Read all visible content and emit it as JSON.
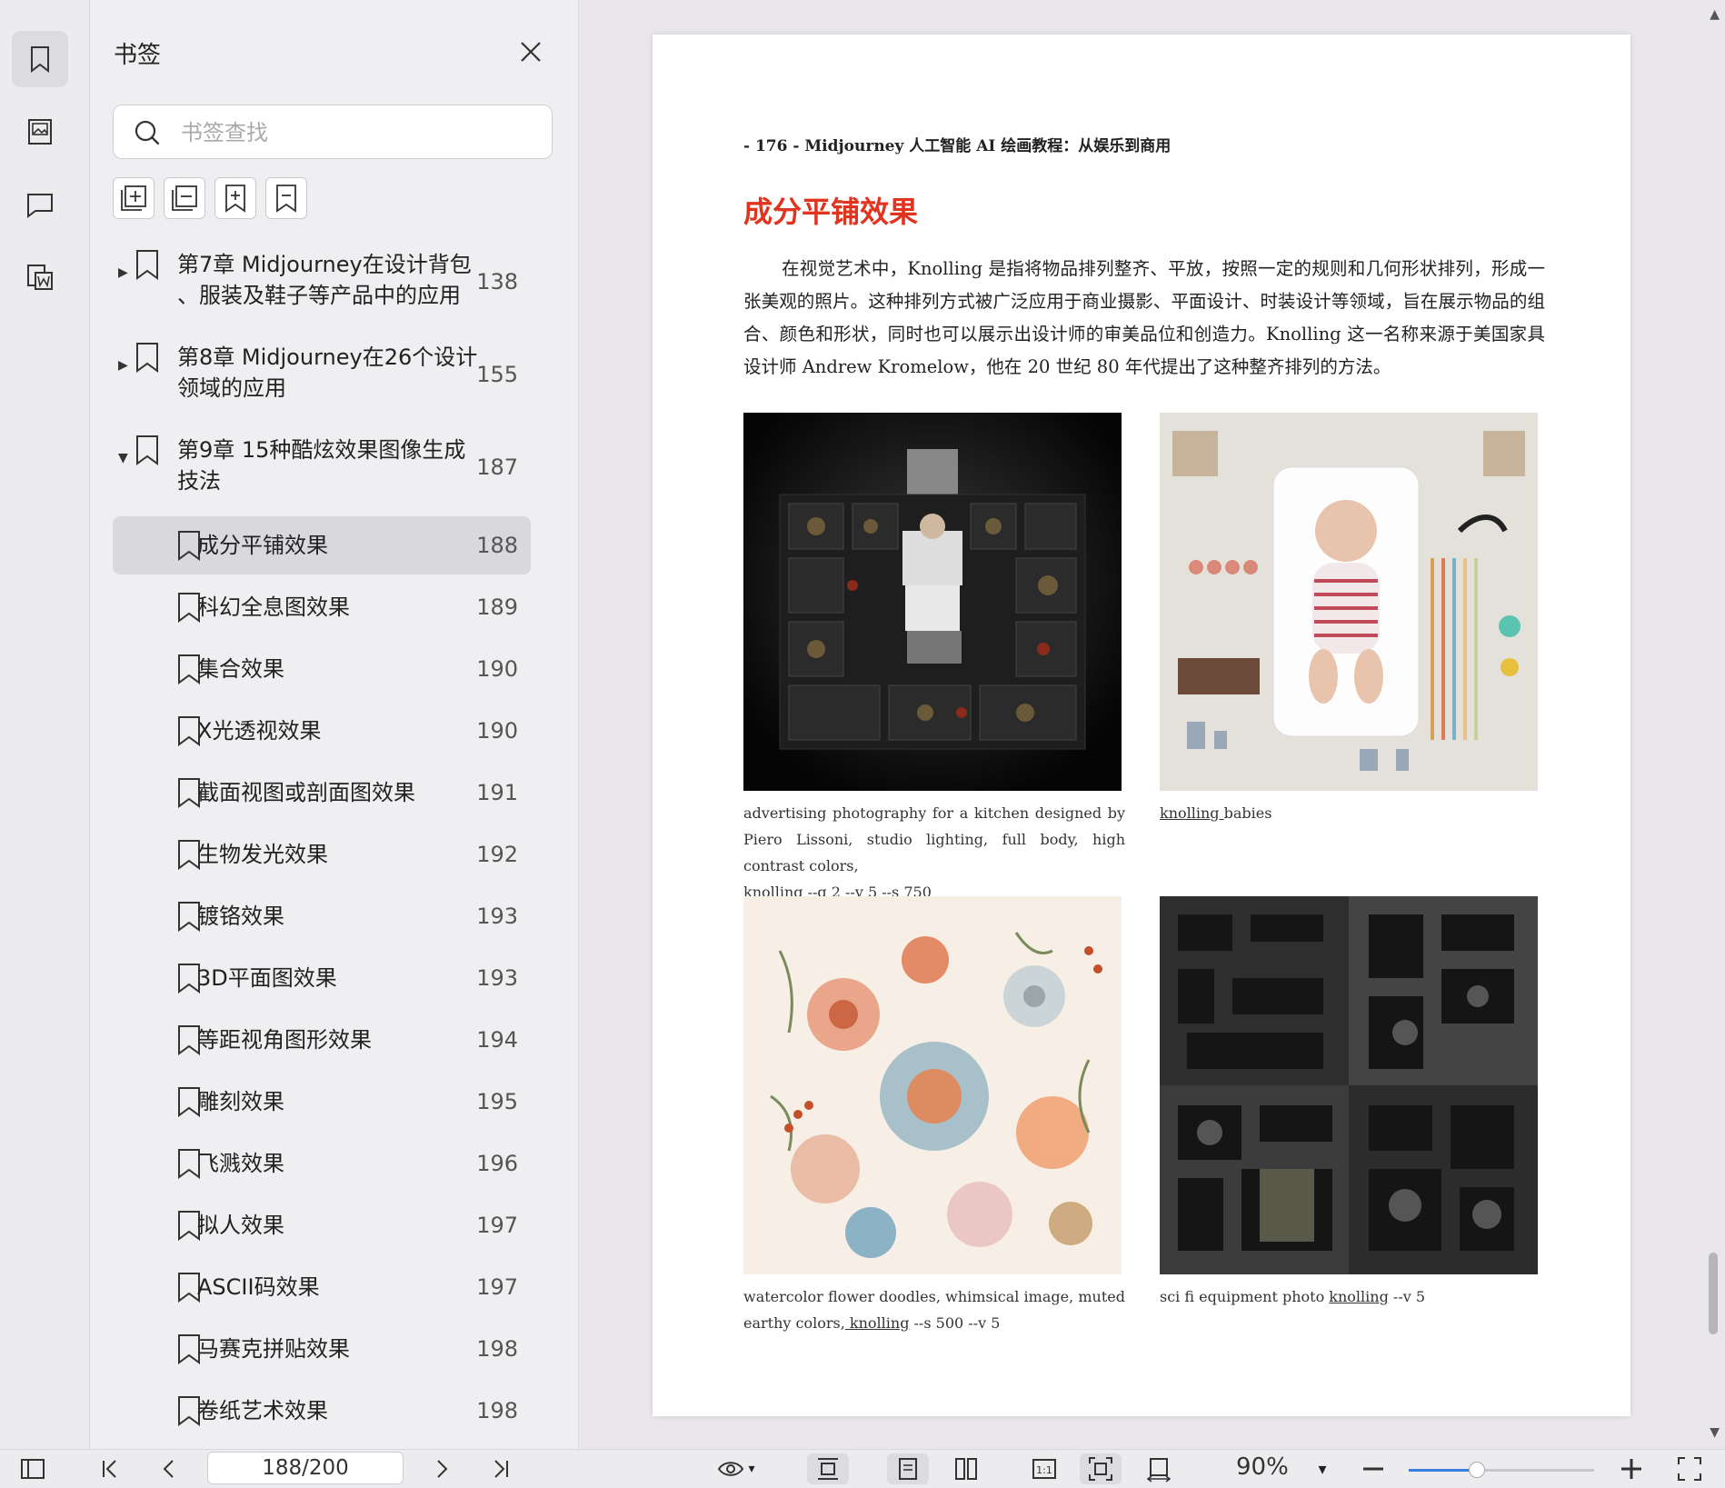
{
  "panel": {
    "title": "书签",
    "search_placeholder": "书签查找"
  },
  "bookmarks": [
    {
      "label": "第7章 Midjourney在设计背包\n、服装及鞋子等产品中的应用",
      "page": "138",
      "level": 0,
      "expanded": false
    },
    {
      "label": "第8章 Midjourney在26个设计\n领域的应用",
      "page": "155",
      "level": 0,
      "expanded": false
    },
    {
      "label": "第9章 15种酷炫效果图像生成\n技法",
      "page": "187",
      "level": 0,
      "expanded": true
    },
    {
      "label": "成分平铺效果",
      "page": "188",
      "level": 1,
      "selected": true
    },
    {
      "label": "科幻全息图效果",
      "page": "189",
      "level": 1
    },
    {
      "label": "集合效果",
      "page": "190",
      "level": 1
    },
    {
      "label": "X光透视效果",
      "page": "190",
      "level": 1
    },
    {
      "label": "截面视图或剖面图效果",
      "page": "191",
      "level": 1
    },
    {
      "label": "生物发光效果",
      "page": "192",
      "level": 1
    },
    {
      "label": "镀铬效果",
      "page": "193",
      "level": 1
    },
    {
      "label": "3D平面图效果",
      "page": "193",
      "level": 1
    },
    {
      "label": "等距视角图形效果",
      "page": "194",
      "level": 1
    },
    {
      "label": "雕刻效果",
      "page": "195",
      "level": 1
    },
    {
      "label": "飞溅效果",
      "page": "196",
      "level": 1
    },
    {
      "label": "拟人效果",
      "page": "197",
      "level": 1
    },
    {
      "label": "ASCII码效果",
      "page": "197",
      "level": 1
    },
    {
      "label": "马赛克拼贴效果",
      "page": "198",
      "level": 1
    },
    {
      "label": "卷纸艺术效果",
      "page": "198",
      "level": 1
    }
  ],
  "document": {
    "running_head": "- 176 -  Midjourney 人工智能 AI 绘画教程：从娱乐到商用",
    "heading": "成分平铺效果",
    "paragraph": "在视觉艺术中，Knolling 是指将物品排列整齐、平放，按照一定的规则和几何形状排列，形成一张美观的照片。这种排列方式被广泛应用于商业摄影、平面设计、时装设计等领域，旨在展示物品的组合、颜色和形状，同时也可以展示出设计师的审美品位和创造力。Knolling 这一名称来源于美国家具设计师 Andrew Kromelow，他在 20 世纪 80 年代提出了这种整齐排列的方法。",
    "captions": {
      "c1_a": "advertising photography for a kitchen designed by Piero Lissoni, studio lighting, full body, high contrast colors,",
      "c1_link": "knolling",
      "c1_b": " --q 2 --v 5 --s 750",
      "c2_link": "knolling ",
      "c2_b": "babies",
      "c3_a": "watercolor flower doodles, whimsical image, muted earthy colors,",
      "c3_link": " knolling",
      "c3_b": " --s 500 --v 5",
      "c4_a": "sci fi equipment photo ",
      "c4_link": "knolling",
      "c4_b": " --v 5"
    }
  },
  "bottom": {
    "page_indicator": "188/200",
    "zoom": "90%",
    "zoom_fraction": 0.37
  },
  "colors": {
    "heading": "#e0341f",
    "accent": "#3b7ee0"
  }
}
